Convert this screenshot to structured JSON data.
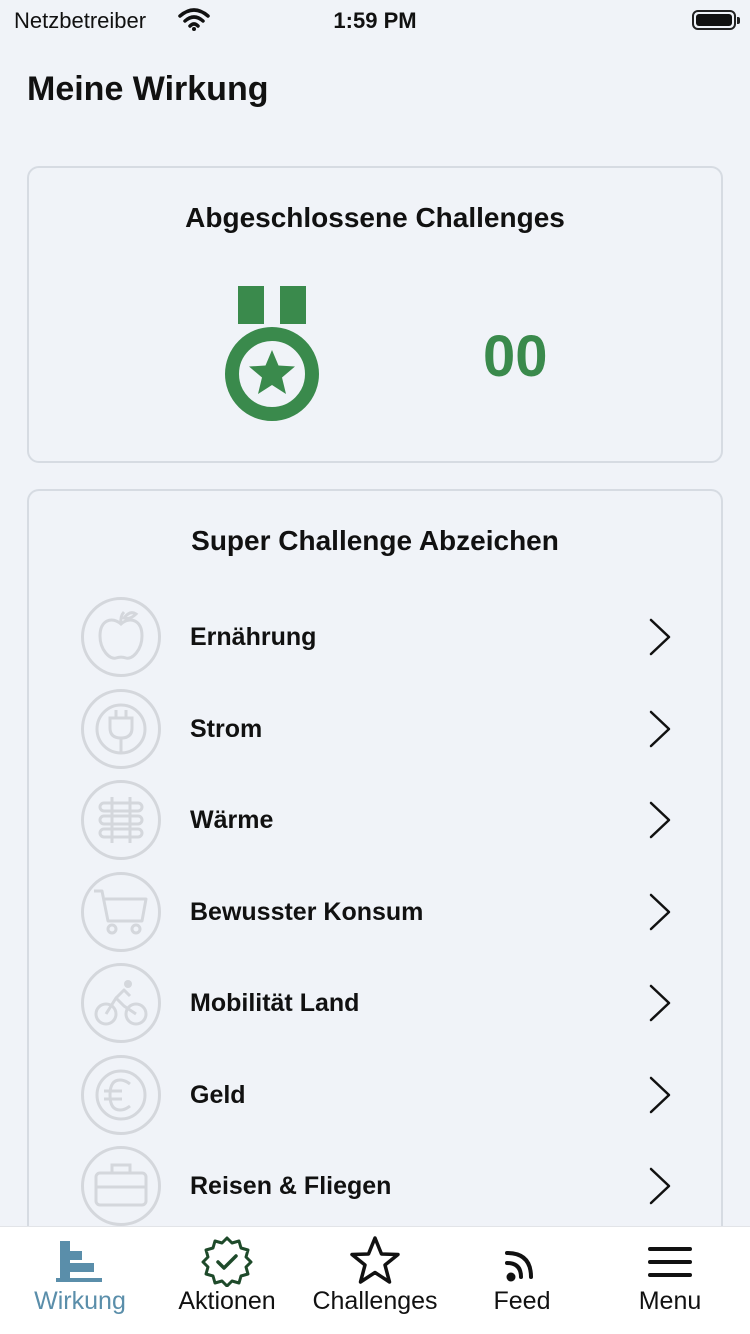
{
  "status_bar": {
    "carrier": "Netzbetreiber",
    "time": "1:59 PM"
  },
  "page": {
    "title": "Meine Wirkung"
  },
  "completed": {
    "title": "Abgeschlossene Challenges",
    "count": "00",
    "accent_color": "#3a8a4c"
  },
  "badges": {
    "title": "Super Challenge Abzeichen",
    "items": [
      {
        "label": "Ernährung",
        "icon": "apple-icon"
      },
      {
        "label": "Strom",
        "icon": "plug-icon"
      },
      {
        "label": "Wärme",
        "icon": "radiator-icon"
      },
      {
        "label": "Bewusster Konsum",
        "icon": "cart-icon"
      },
      {
        "label": "Mobilität Land",
        "icon": "cyclist-icon"
      },
      {
        "label": "Geld",
        "icon": "euro-icon"
      },
      {
        "label": "Reisen & Fliegen",
        "icon": "suitcase-icon"
      }
    ]
  },
  "tabs": [
    {
      "label": "Wirkung",
      "icon": "impact-chart-icon",
      "active": true
    },
    {
      "label": "Aktionen",
      "icon": "check-badge-icon",
      "active": false
    },
    {
      "label": "Challenges",
      "icon": "star-icon",
      "active": false
    },
    {
      "label": "Feed",
      "icon": "feed-icon",
      "active": false
    },
    {
      "label": "Menu",
      "icon": "hamburger-menu-icon",
      "active": false
    }
  ],
  "colors": {
    "active_tab": "#5a8eaa",
    "badge_gray": "#d4d7dc",
    "background": "#f0f3f8"
  }
}
